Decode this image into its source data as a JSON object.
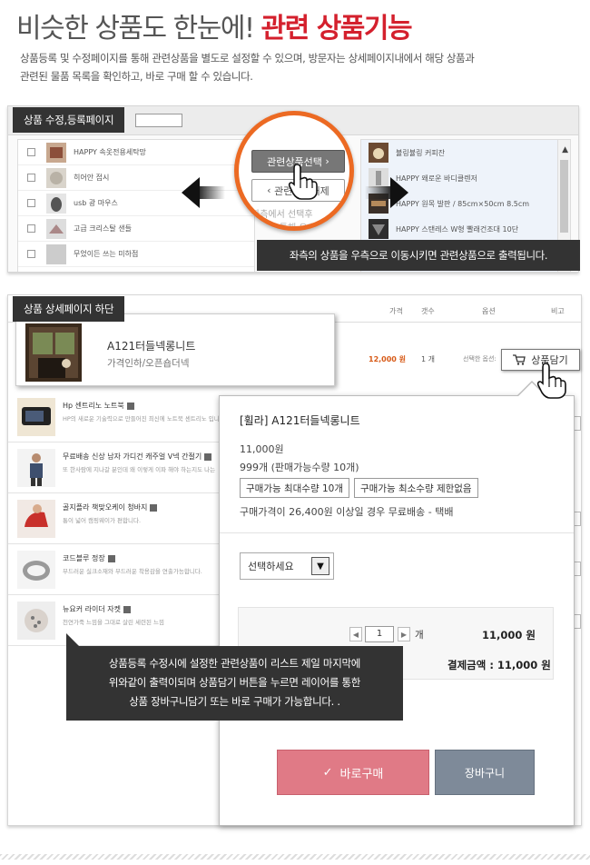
{
  "hero": {
    "title_plain": "비슷한 상품도 한눈에! ",
    "title_accent": "관련 상품기능",
    "desc_line1": "상품등록 및 수정페이지를 통해 관련상품을 별도로 설정할 수 있으며, 방문자는 상세페이지내에서 해당 상품과",
    "desc_line2": "관련된 물품 목록을 확인하고, 바로 구매 할 수 있습니다."
  },
  "section1": {
    "tag": "상품 수정,등록페이지",
    "left_items": [
      {
        "label": "HAPPY 속옷전용세탁망"
      },
      {
        "label": "히어안 접시"
      },
      {
        "label": "usb 광 마우스"
      },
      {
        "label": "고급 크리스탈 샌들"
      },
      {
        "label": "무었이든 쓰는 미하점"
      }
    ],
    "right_items": [
      {
        "label": "뷸링뷸링 커피잔"
      },
      {
        "label": "HAPPY 왜로운 바디클렌저"
      },
      {
        "label": "HAPPY 원목 발판 / 85cm×50cm 8.5cm"
      },
      {
        "label": "HAPPY 스탠레스 W형 빨래건조대 10단"
      }
    ],
    "btn_related": "관련상품선택",
    "btn_release": "관련상품해제",
    "mag_text_line1": "좌측에서 선택후",
    "mag_text_line2": "버튼을 통해 우측으로",
    "callout": "좌측의 상품을 우측으로 이동시키면 관련상품으로 출력됩니다."
  },
  "section2": {
    "tag": "상품 상세페이지 하단",
    "col_headers": [
      "가격",
      "갯수",
      "옵션",
      "비고"
    ],
    "featured": {
      "title": "A121터들넥롱니트",
      "subtitle": "가격인하/오픈숍더넥",
      "price": "12,000 원",
      "qty": "1 개",
      "option": "선택한 옵션:"
    },
    "products": [
      {
        "name": "Hp 센트리노 노트북",
        "desc": "HP의 새로운 기술력으로 만들어진 최신에 노트북 센트리노 입니다"
      },
      {
        "name": "무료배송 신상 남자 가디건 캐주얼 V넥 간절기",
        "desc": "또 한사람에 지나갈 분인데 왜 이렇게 이파 해야 하는지도 나는"
      },
      {
        "name": "골지플라 책맞오케이 청바지",
        "desc": "통이 넓어 캠핑웨이가 편합니다."
      },
      {
        "name": "코드블루 정장",
        "desc": "부드러운 실크소재와 부드러운 착용감을 연출가능합니다."
      },
      {
        "name": "뉴요커 라이더 자켓",
        "desc": "천연가죽 느낌을 그대로 살린 세련된 느낌"
      }
    ],
    "cart_button": "상품담기",
    "layer": {
      "title": "[휠라] A121터들넥롱니트",
      "price": "11,000원",
      "stock": "999개 (판매가능수량 10개)",
      "chip_max": "구매가능 최대수량 10개",
      "chip_min": "구매가능 최소수량 제한없음",
      "shipping": "구매가격이 26,400원 이상일 경우 무료배송 - 택배",
      "select_placeholder": "선택하세요",
      "qty_value": "1",
      "qty_unit": "개",
      "line_price": "11,000 원",
      "total": "결제금액 : 11,000 원",
      "buy_button": "바로구매",
      "cart_button": "장바구니"
    },
    "callout_line1": "상품등록 수정시에 설정한 관련상품이 리스트 제일 마지막에",
    "callout_line2": "위와같이 출력이되며 상품담기 버튼을 누르면 레이어를 통한",
    "callout_line3": "상품 장바구니담기 또는 바로 구매가 가능합니다. ."
  },
  "colors": {
    "accent": "#d4202d",
    "orange_ring": "#ec6a23",
    "buy_button": "#e07a86",
    "cart_button": "#7e8a99",
    "tag_bg": "#333333"
  }
}
